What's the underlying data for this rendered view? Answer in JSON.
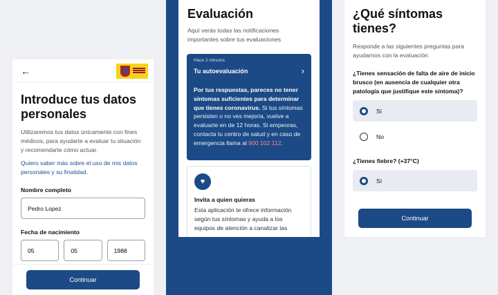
{
  "screen1": {
    "back_icon": "arrow-left-icon",
    "title": "Introduce tus datos personales",
    "description": "Utilizaremos tus datos únicamente con fines médicos, para ayudarte a evaluar tu situación y recomendarte cómo actuar.",
    "link": "Quiero saber más sobre el uso de mis datos personales y su finalidad.",
    "name_label": "Nombre completo",
    "name_value": "Pedro Lopez",
    "dob_label": "Fecha de nacimiento",
    "dob_day": "05",
    "dob_month": "05",
    "dob_year": "1988",
    "continue": "Continuar"
  },
  "screen2": {
    "title": "Evaluación",
    "subtitle": "Aquí verás todas las notificaciones importantes sobre tus evaluaciones",
    "card": {
      "time": "Hace 2 minutos",
      "title": "Tu autoevaluación",
      "body_bold": "Por tus respuestas, pareces no tener síntomas suficientes para determinar que tienes coronavirus.",
      "body_rest": " Si tus síntomas persisten o no ves mejoría, vuelve a evaluarte en de 12 horas. Si empeoras, contacta tu centro de salud y en caso de emergencia llama al ",
      "phone": "900 102 112",
      "end": "."
    },
    "invite": {
      "icon": "heart-icon",
      "title": "Invita a quien quieras",
      "body": "Esta aplicación te ofrece información según tus síntomas y ayuda a los equipos de atención a canalizar las"
    }
  },
  "screen3": {
    "title": "¿Qué síntomas tienes?",
    "subtitle": "Responde a las siguientes preguntas para ayudarnos con la evaluación",
    "q1": "¿Tienes sensación de falta de aire de inicio brusco (en ausencia de cualquier otra patología que justifique este síntoma)?",
    "q1_yes": "Sí",
    "q1_no": "No",
    "q2": "¿Tienes fiebre? (+37°C)",
    "q2_yes": "Sí",
    "continue": "Continuar"
  },
  "colors": {
    "primary": "#1b4a86",
    "phone_accent": "#ff8a8a"
  }
}
